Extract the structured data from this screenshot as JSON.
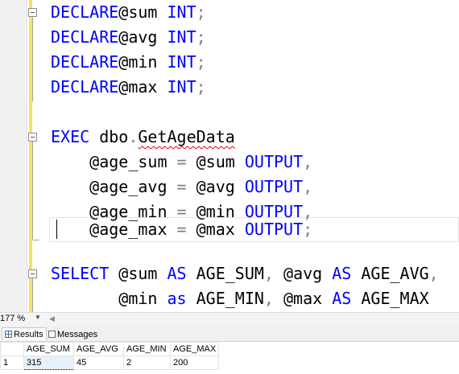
{
  "editor": {
    "lines": [
      {
        "tokens": [
          [
            "kw",
            "DECLARE"
          ],
          [
            "",
            "@sum "
          ],
          [
            "kw",
            "INT"
          ],
          [
            "gray",
            ";"
          ]
        ]
      },
      {
        "tokens": [
          [
            "kw",
            "DECLARE"
          ],
          [
            "",
            "@avg "
          ],
          [
            "kw",
            "INT"
          ],
          [
            "gray",
            ";"
          ]
        ]
      },
      {
        "tokens": [
          [
            "kw",
            "DECLARE"
          ],
          [
            "",
            "@min "
          ],
          [
            "kw",
            "INT"
          ],
          [
            "gray",
            ";"
          ]
        ]
      },
      {
        "tokens": [
          [
            "kw",
            "DECLARE"
          ],
          [
            "",
            "@max "
          ],
          [
            "kw",
            "INT"
          ],
          [
            "gray",
            ";"
          ]
        ]
      },
      {
        "tokens": []
      },
      {
        "tokens": [
          [
            "kw",
            "EXEC "
          ],
          [
            "",
            "dbo"
          ],
          [
            "gray",
            "."
          ],
          [
            "squig",
            "GetAgeData"
          ]
        ]
      },
      {
        "tokens": [
          [
            "",
            "    @age_sum "
          ],
          [
            "gray",
            "= "
          ],
          [
            "",
            "@sum "
          ],
          [
            "kw",
            "OUTPUT"
          ],
          [
            "gray",
            ","
          ]
        ]
      },
      {
        "tokens": [
          [
            "",
            "    @age_avg "
          ],
          [
            "gray",
            "= "
          ],
          [
            "",
            "@avg "
          ],
          [
            "kw",
            "OUTPUT"
          ],
          [
            "gray",
            ","
          ]
        ]
      },
      {
        "tokens": [
          [
            "",
            "    @age_min "
          ],
          [
            "gray",
            "= "
          ],
          [
            "",
            "@min "
          ],
          [
            "kw",
            "OUTPUT"
          ],
          [
            "gray",
            ","
          ]
        ]
      },
      {
        "tokens": [
          [
            "",
            "    @age_max "
          ],
          [
            "gray",
            "= "
          ],
          [
            "",
            "@max "
          ],
          [
            "kw",
            "OUTPUT"
          ],
          [
            "gray",
            ";"
          ]
        ]
      },
      {
        "tokens": []
      },
      {
        "tokens": [
          [
            "kw",
            "SELECT "
          ],
          [
            "",
            "@sum "
          ],
          [
            "kw",
            "AS "
          ],
          [
            "",
            "AGE_SUM"
          ],
          [
            "gray",
            ", "
          ],
          [
            "",
            "@avg "
          ],
          [
            "kw",
            "AS "
          ],
          [
            "",
            "AGE_AVG"
          ],
          [
            "gray",
            ","
          ]
        ]
      },
      {
        "tokens": [
          [
            "",
            "       @min "
          ],
          [
            "kw",
            "as "
          ],
          [
            "",
            "AGE_MIN"
          ],
          [
            "gray",
            ", "
          ],
          [
            "",
            "@max "
          ],
          [
            "kw",
            "AS "
          ],
          [
            "",
            "AGE_MAX"
          ]
        ]
      }
    ]
  },
  "status": {
    "zoom": "177 %"
  },
  "result_tabs": [
    "Results",
    "Messages"
  ],
  "results": {
    "columns": [
      "AGE_SUM",
      "AGE_AVG",
      "AGE_MIN",
      "AGE_MAX"
    ],
    "rows": [
      {
        "num": "1",
        "cells": [
          "315",
          "45",
          "2",
          "200"
        ]
      }
    ]
  },
  "colors": {
    "keyword": "#0000ff",
    "operator": "#808080",
    "changebar": "#f7e25f"
  }
}
